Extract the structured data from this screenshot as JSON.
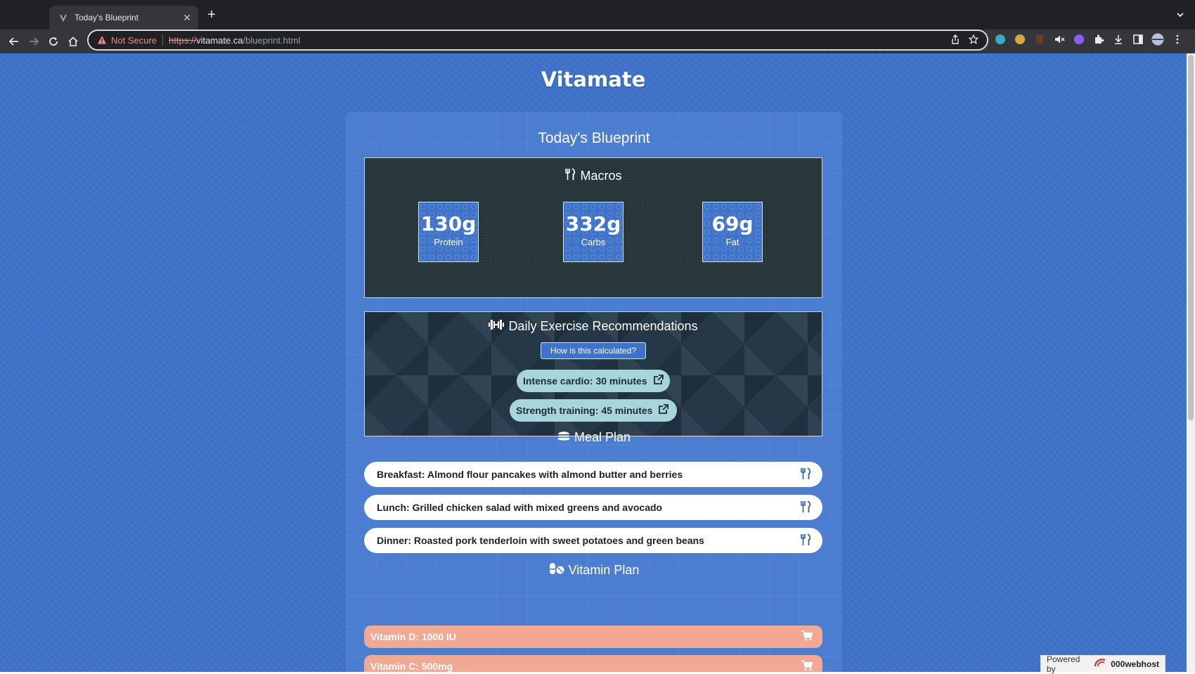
{
  "browser": {
    "tab_title": "Today's Blueprint",
    "new_tab": "+",
    "not_secure": "Not Secure",
    "url_scheme": "https://",
    "url_host": "vitamate.ca",
    "url_path": "/blueprint.html"
  },
  "site": {
    "title": "Vitamate"
  },
  "blueprint": {
    "title": "Today's Blueprint",
    "macros": {
      "heading": "Macros",
      "items": [
        {
          "value": "130g",
          "label": "Protein"
        },
        {
          "value": "332g",
          "label": "Carbs"
        },
        {
          "value": "69g",
          "label": "Fat"
        }
      ]
    },
    "exercise": {
      "heading": "Daily Exercise Recommendations",
      "calc_button": "How is this calculated?",
      "items": [
        {
          "label": "Intense cardio: 30 minutes"
        },
        {
          "label": "Strength training: 45 minutes"
        }
      ]
    },
    "meal_plan": {
      "heading": "Meal Plan",
      "items": [
        {
          "label": "Breakfast: Almond flour pancakes with almond butter and berries"
        },
        {
          "label": "Lunch: Grilled chicken salad with mixed greens and avocado"
        },
        {
          "label": "Dinner: Roasted pork tenderloin with sweet potatoes and green beans"
        }
      ]
    },
    "vitamin_plan": {
      "heading": "Vitamin Plan",
      "items": [
        {
          "label": "Vitamin D: 1000 IU"
        },
        {
          "label": "Vitamin C: 500mg"
        }
      ]
    }
  },
  "footer": {
    "powered_by": "Powered by",
    "brand": "000webhost"
  },
  "colors": {
    "page_bg": "#3f73c9",
    "macros_panel": "#26353a",
    "exercise_pill": "#a8d5dc",
    "vitamin_item": "#f2a994",
    "not_secure": "#f28b82"
  },
  "icons": {
    "macros": "utensils-icon",
    "exercise": "dumbbell-icon",
    "exercise_link": "external-link-icon",
    "meal": "hamburger-icon",
    "meal_item": "utensils-icon",
    "vitamin": "pills-icon",
    "vitamin_item": "cart-icon"
  }
}
